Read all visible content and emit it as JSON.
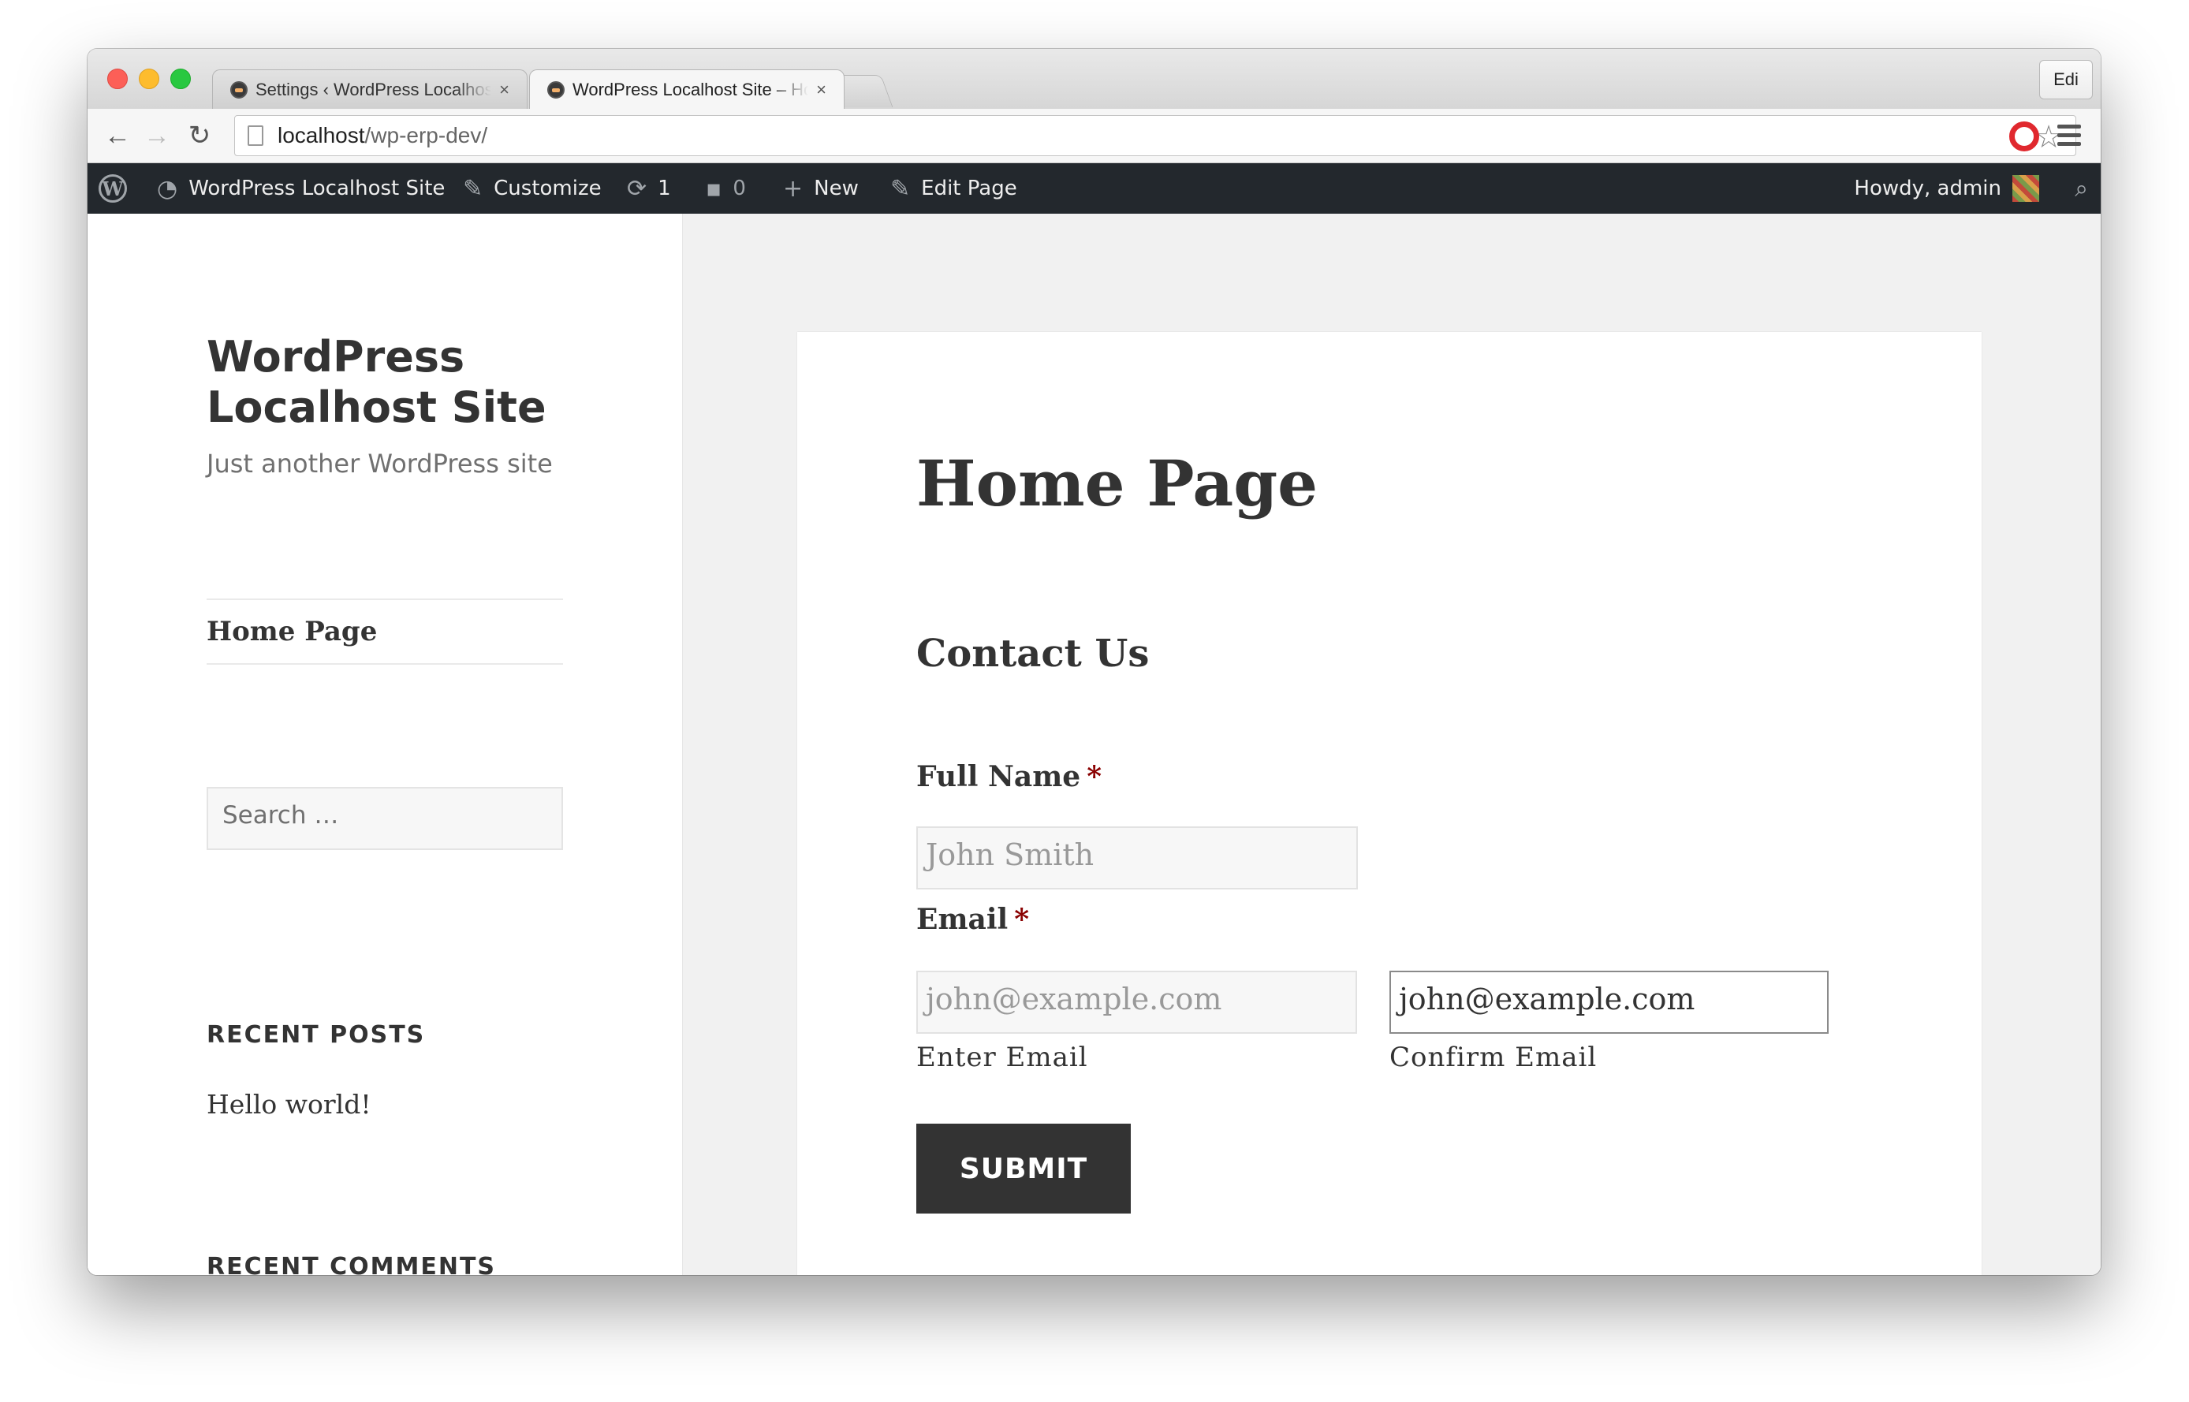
{
  "browser": {
    "tabs": [
      {
        "title": "Settings ‹ WordPress Localhost Site",
        "close": "×"
      },
      {
        "title": "WordPress Localhost Site – Home Page",
        "close": "×"
      }
    ],
    "profile_button": "Edi",
    "url_host": "localhost",
    "url_path": "/wp-erp-dev/",
    "back_icon": "←",
    "forward_icon": "→",
    "reload_icon": "↻",
    "star_icon": "☆"
  },
  "adminbar": {
    "site_name": "WordPress Localhost Site",
    "customize": "Customize",
    "updates_count": "1",
    "comments_count": "0",
    "new": "New",
    "edit_page": "Edit Page",
    "howdy": "Howdy, admin",
    "icons": {
      "wp": "W",
      "dashboard": "◔",
      "customize": "✎",
      "updates": "⟳",
      "comments": "▪",
      "new": "+",
      "edit": "✎",
      "search": "⌕"
    }
  },
  "sidebar": {
    "site_title": "WordPress Localhost Site",
    "tagline": "Just another WordPress site",
    "nav_home": "Home Page",
    "search_placeholder": "Search …",
    "recent_posts_title": "RECENT POSTS",
    "recent_post_1": "Hello world!",
    "recent_comments_title": "RECENT COMMENTS"
  },
  "content": {
    "page_title": "Home Page",
    "form_title": "Contact Us",
    "full_name_label": "Full Name",
    "required_mark": "*",
    "full_name_placeholder": "John Smith",
    "email_label": "Email",
    "email_placeholder": "john@example.com",
    "confirm_email_value": "john@example.com",
    "enter_email_sublabel": "Enter Email",
    "confirm_email_sublabel": "Confirm Email",
    "submit_label": "SUBMIT"
  }
}
